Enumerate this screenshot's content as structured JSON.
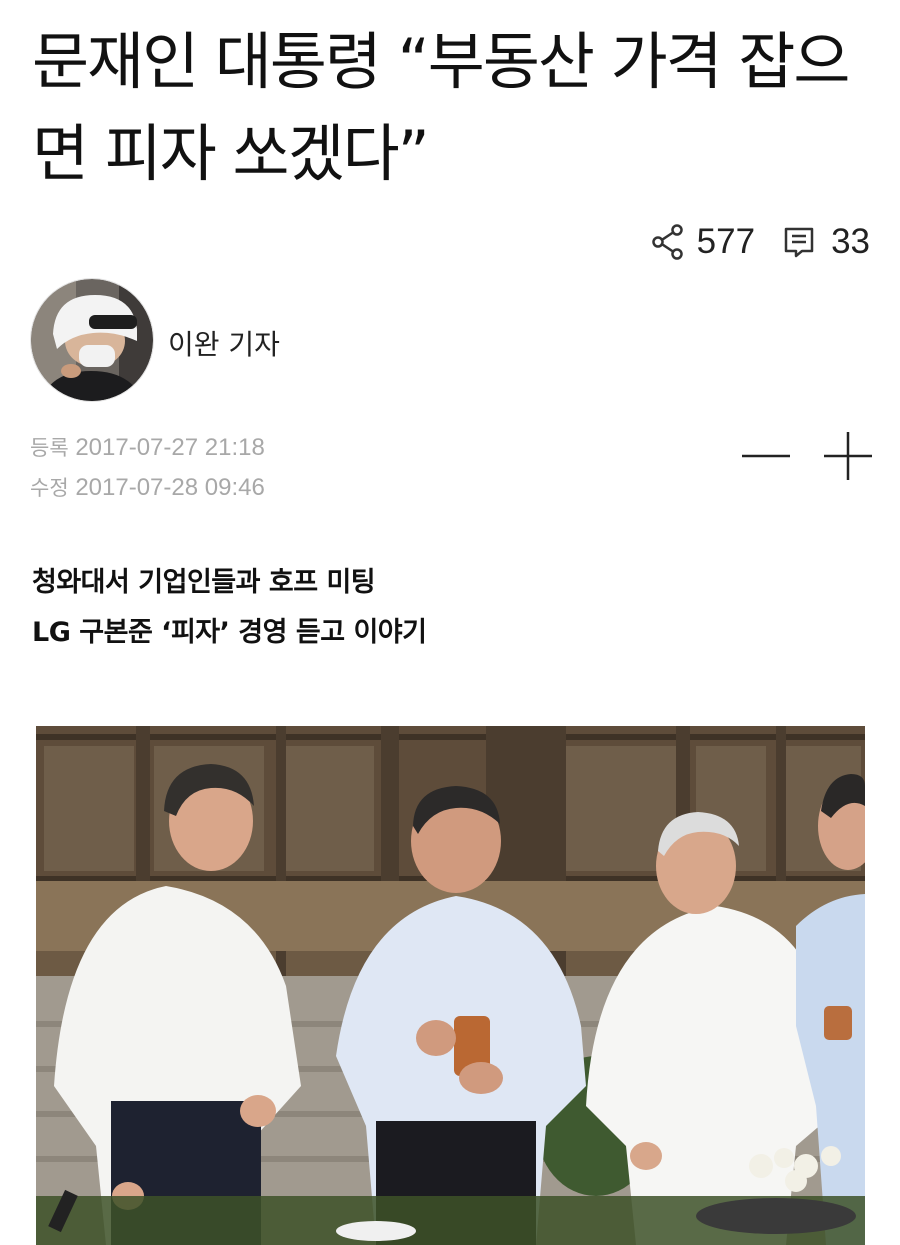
{
  "article": {
    "headline": "문재인 대통령 “부동산 가격 잡으면 피자 쏘겠다”",
    "share_count": "577",
    "comment_count": "33",
    "author": "이완 기자",
    "registered_label": "등록",
    "registered_time": "2017-07-27 21:18",
    "modified_label": "수정",
    "modified_time": "2017-07-28 09:46",
    "subheads": [
      "청와대서 기업인들과 호프 미팅",
      "LG 구본준 ‘피자’ 경영 듣고 이야기"
    ]
  },
  "icons": {
    "share": "share-icon",
    "comments": "comment-icon",
    "font_decrease": "minus-icon",
    "font_increase": "plus-icon"
  }
}
